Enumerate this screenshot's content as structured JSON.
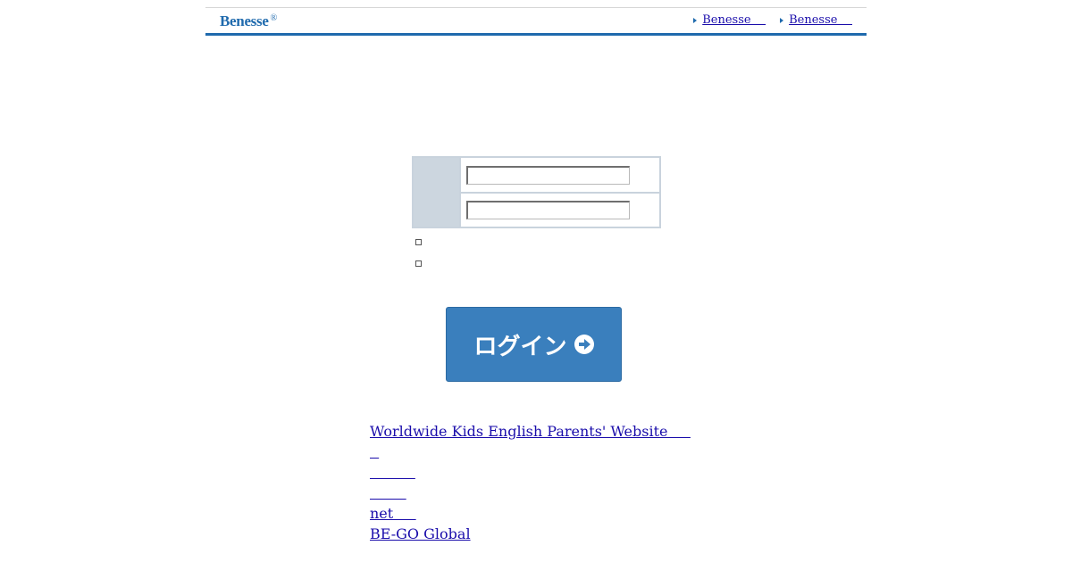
{
  "header": {
    "logo_text": "Benesse",
    "logo_mark": "®",
    "links": [
      {
        "label": "Benesse    ",
        "icon": "arrow-right-icon"
      },
      {
        "label": "Benesse    ",
        "icon": "arrow-right-icon"
      }
    ]
  },
  "login": {
    "user_value": "",
    "password_value": "",
    "button_label": "ログイン",
    "button_icon": "circle-arrow-right-icon"
  },
  "links": [
    "Worldwide Kids English Parents' Website     ",
    "  ",
    "          ",
    "        ",
    "net     ",
    "BE-GO Global"
  ],
  "colors": {
    "brand": "#1f6aad",
    "button": "#3a7fbd",
    "table_label_bg": "#ccd6df",
    "link": "#1a0dab"
  }
}
